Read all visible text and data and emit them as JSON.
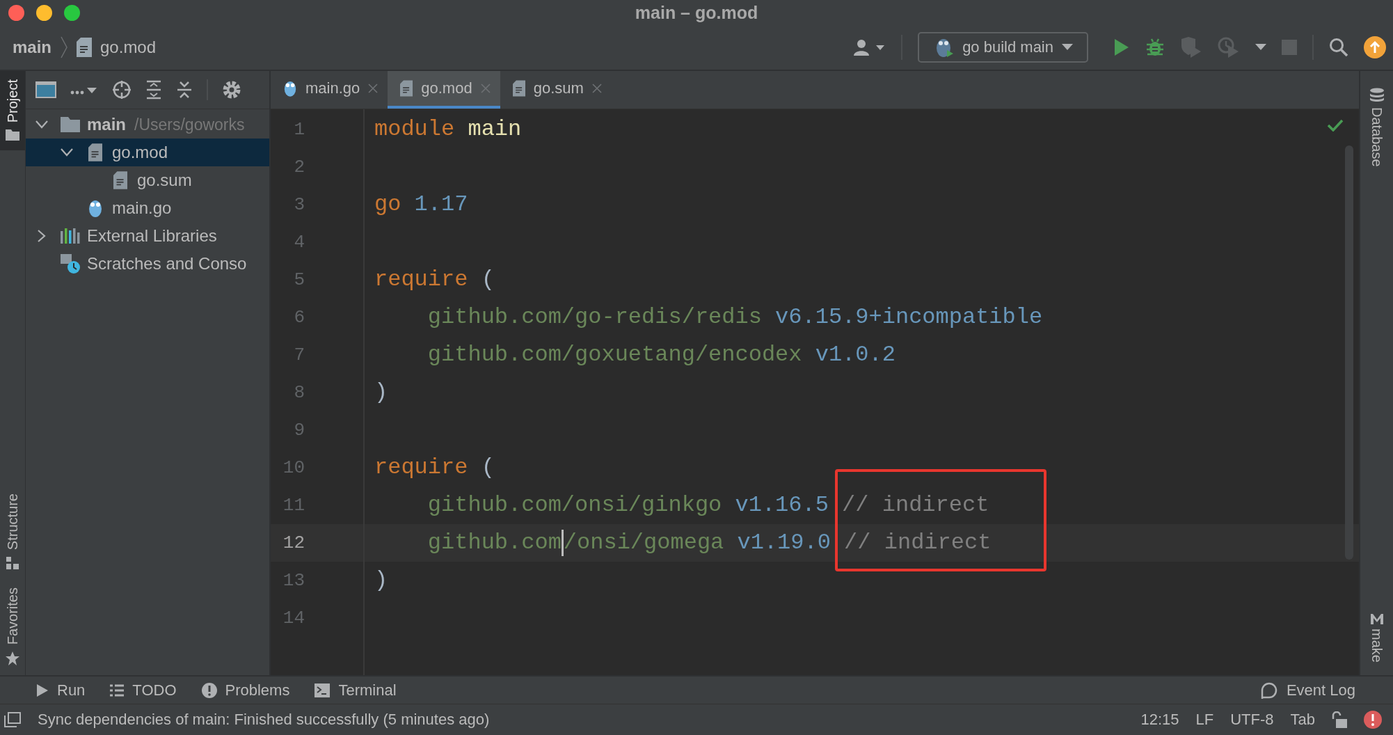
{
  "window": {
    "title": "main – go.mod"
  },
  "breadcrumb": [
    {
      "kind": "project",
      "label": "main"
    },
    {
      "kind": "file",
      "label": "go.mod"
    }
  ],
  "run_configuration": {
    "label": "go build main"
  },
  "left_tools_top": [
    {
      "label": "Project",
      "selected": true
    }
  ],
  "left_tools_bottom": [
    {
      "label": "Structure",
      "selected": false
    },
    {
      "label": "Favorites",
      "selected": false
    }
  ],
  "right_tools_top": [
    {
      "kind": "database",
      "label": "Database"
    }
  ],
  "right_tools_bottom": [
    {
      "kind": "make",
      "label": "make"
    }
  ],
  "project_tree": [
    {
      "kind": "folder",
      "label": "main",
      "path": "/Users/goworks",
      "expanded": true,
      "selected": false,
      "children": [
        {
          "kind": "file",
          "label": "go.mod",
          "expanded": true,
          "selected": true,
          "children": [
            {
              "kind": "file",
              "label": "go.sum",
              "selected": false
            }
          ]
        },
        {
          "kind": "gopher",
          "label": "main.go",
          "selected": false
        }
      ]
    },
    {
      "kind": "libraries",
      "label": "External Libraries",
      "expanded": false,
      "selected": false
    },
    {
      "kind": "scratches",
      "label": "Scratches and Conso",
      "selected": false
    }
  ],
  "tabs": [
    {
      "kind": "gopher",
      "label": "main.go",
      "selected": false
    },
    {
      "kind": "file",
      "label": "go.mod",
      "selected": true
    },
    {
      "kind": "file",
      "label": "go.sum",
      "selected": false
    }
  ],
  "editor": {
    "lines": [
      {
        "number": "1",
        "current": false,
        "tokens": [
          {
            "kind": "keyword",
            "text": "module"
          },
          {
            "kind": "name",
            "text": " main"
          }
        ]
      },
      {
        "number": "2",
        "current": false
      },
      {
        "number": "3",
        "current": false,
        "tokens": [
          {
            "kind": "keyword",
            "text": "go"
          },
          {
            "kind": "version",
            "text": " 1.17"
          }
        ]
      },
      {
        "number": "4",
        "current": false
      },
      {
        "number": "5",
        "current": false,
        "tokens": [
          {
            "kind": "keyword",
            "text": "require"
          },
          {
            "kind": "punct",
            "text": " ("
          }
        ]
      },
      {
        "number": "6",
        "current": false,
        "tokens": [
          {
            "kind": "path",
            "text": "    github.com/go-redis/redis"
          },
          {
            "kind": "version",
            "text": " v6.15.9+incompatible"
          }
        ]
      },
      {
        "number": "7",
        "current": false,
        "tokens": [
          {
            "kind": "path",
            "text": "    github.com/goxuetang/encodex"
          },
          {
            "kind": "version",
            "text": " v1.0.2"
          }
        ]
      },
      {
        "number": "8",
        "current": false,
        "tokens": [
          {
            "kind": "punct",
            "text": ")"
          }
        ]
      },
      {
        "number": "9",
        "current": false
      },
      {
        "number": "10",
        "current": false,
        "tokens": [
          {
            "kind": "keyword",
            "text": "require"
          },
          {
            "kind": "punct",
            "text": " ("
          }
        ]
      },
      {
        "number": "11",
        "current": false,
        "tokens": [
          {
            "kind": "path",
            "text": "    github.com/onsi/ginkgo"
          },
          {
            "kind": "version",
            "text": " v1.16.5"
          },
          {
            "kind": "comment",
            "text": " // indirect"
          }
        ]
      },
      {
        "number": "12",
        "current": true,
        "tokens": [
          {
            "kind": "path",
            "text": "    github.com"
          },
          {
            "kind": "caret"
          },
          {
            "kind": "path",
            "text": "/onsi/gomega"
          },
          {
            "kind": "version",
            "text": " v1.19.0"
          },
          {
            "kind": "comment",
            "text": " // indirect"
          }
        ]
      },
      {
        "number": "13",
        "current": false,
        "tokens": [
          {
            "kind": "punct",
            "text": ")"
          }
        ]
      },
      {
        "number": "14",
        "current": false
      }
    ]
  },
  "bottom_tools": [
    {
      "kind": "run",
      "label": "Run"
    },
    {
      "kind": "todo",
      "label": "TODO"
    },
    {
      "kind": "problems",
      "label": "Problems"
    },
    {
      "kind": "terminal",
      "label": "Terminal"
    }
  ],
  "event_log": {
    "label": "Event Log"
  },
  "status_bar": {
    "message": "Sync dependencies of main: Finished successfully (5 minutes ago)",
    "items": [
      "12:15",
      "LF",
      "UTF-8",
      "Tab"
    ]
  }
}
